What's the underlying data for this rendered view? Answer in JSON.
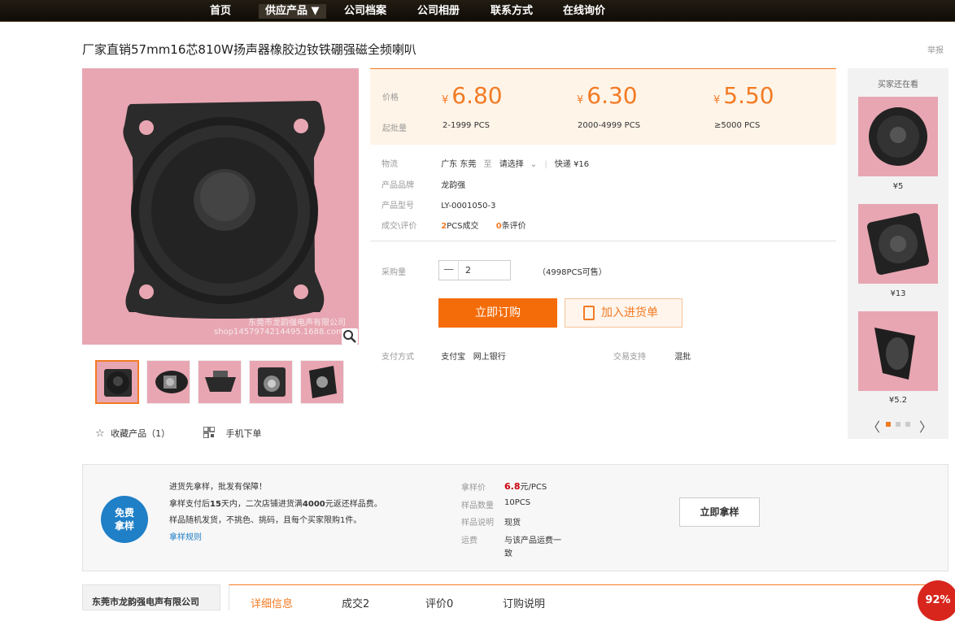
{
  "nav": {
    "items": [
      "首页",
      "供应产品 ▼",
      "公司档案",
      "公司相册",
      "联系方式",
      "在线询价"
    ]
  },
  "product": {
    "title": "厂家直销57mm16芯810W扬声器橡胶边钕铁硼强磁全频喇叭",
    "report": "举报",
    "watermark_line1": "东莞市龙韵强电声有限公司",
    "watermark_line2": "shop1457974214495.1688.com"
  },
  "price_box": {
    "price_label": "价格",
    "moq_label": "起批量",
    "currency": "¥",
    "tiers": [
      {
        "price": "6.80",
        "range": "2-1999 PCS"
      },
      {
        "price": "6.30",
        "range": "2000-4999 PCS"
      },
      {
        "price": "5.50",
        "range": "≥5000 PCS"
      }
    ]
  },
  "details": {
    "logistics_label": "物流",
    "logistics_from": "广东 东莞",
    "logistics_to": "至",
    "logistics_select": "请选择",
    "logistics_express": "快递 ¥16",
    "brand_label": "产品品牌",
    "brand": "龙韵强",
    "model_label": "产品型号",
    "model": "LY-0001050-3",
    "deal_label": "成交\\评价",
    "deal_count": "2",
    "deal_unit": "PCS成交",
    "review_count": "0",
    "review_unit": "条评价"
  },
  "purchase": {
    "qty_label": "采购量",
    "minus": "—",
    "qty_value": "2",
    "available": "（4998PCS可售）",
    "order_button": "立即订购",
    "cart_button": "加入进货单",
    "pay_label": "支付方式",
    "pay_methods": "支付宝   网上银行",
    "support_label": "交易支持",
    "support_value": "混批"
  },
  "actions": {
    "favorite": "收藏产品（1）",
    "mobile": "手机下单"
  },
  "side": {
    "title": "买家还在看",
    "items": [
      {
        "price": "¥5"
      },
      {
        "price": "¥13"
      },
      {
        "price": "¥5.2"
      }
    ],
    "prev": "〈",
    "next": "〉"
  },
  "sample": {
    "badge_line1": "免费",
    "badge_line2": "拿样",
    "line1": "进货先拿样，批发有保障！",
    "line2_a": "拿样支付后",
    "line2_b": "15",
    "line2_c": "天内，二次店铺进货满",
    "line2_d": "4000",
    "line2_e": "元返还样品费。",
    "line3": "样品随机发货，不挑色、挑码，且每个买家限购1件。",
    "rules_link": "拿样规则",
    "price_label": "拿样价",
    "price_value": "6.8",
    "price_unit": "元/PCS",
    "qty_label": "样品数量",
    "qty_value": "10PCS",
    "desc_label": "样品说明",
    "desc_value": "现货",
    "ship_label": "运费",
    "ship_value1": "与该产品运费一",
    "ship_value2": "致",
    "button": "立即拿样"
  },
  "bottom": {
    "company": "东莞市龙韵强电声有限公司",
    "tabs": [
      "详细信息",
      "成交2",
      "评价0",
      "订购说明"
    ],
    "badge": "92%"
  },
  "colors": {
    "accent": "#f27b24",
    "order_button": "#f46c0a",
    "sample_badge": "#1f7fc7",
    "percent_badge": "#d8261c",
    "product_background": "#e8a6b2"
  },
  "icons": [
    "magnifier-icon",
    "star-icon",
    "qr-code-icon",
    "clipboard-icon",
    "chevron-down-icon",
    "minus-icon"
  ]
}
